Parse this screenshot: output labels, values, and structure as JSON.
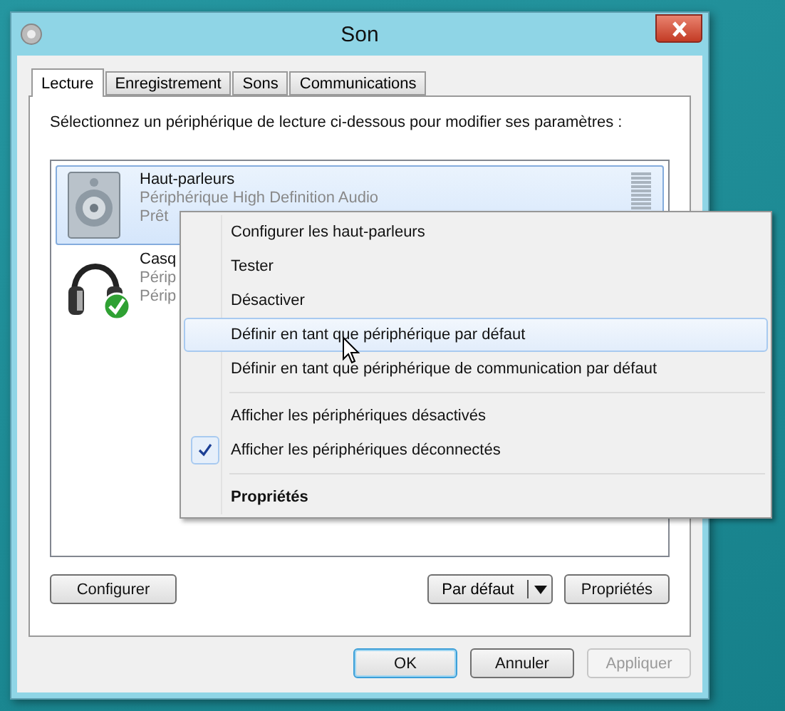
{
  "window": {
    "title": "Son"
  },
  "tabs": [
    {
      "label": "Lecture",
      "selected": true
    },
    {
      "label": "Enregistrement",
      "selected": false
    },
    {
      "label": "Sons",
      "selected": false
    },
    {
      "label": "Communications",
      "selected": false
    }
  ],
  "instruction": "Sélectionnez un périphérique de lecture ci-dessous pour modifier ses paramètres :",
  "devices": [
    {
      "kind": "speaker",
      "name": "Haut-parleurs",
      "description": "Périphérique High Definition Audio",
      "status": "Prêt",
      "selected": true,
      "default": false
    },
    {
      "kind": "headphones",
      "name": "Casq",
      "description": "Périp",
      "status": "Périp",
      "selected": false,
      "default": true
    }
  ],
  "panel_buttons": {
    "configure": "Configurer",
    "set_default": "Par défaut",
    "properties": "Propriétés"
  },
  "dialog_buttons": [
    {
      "label": "OK",
      "disabled": false,
      "focused": true
    },
    {
      "label": "Annuler",
      "disabled": false,
      "focused": false
    },
    {
      "label": "Appliquer",
      "disabled": true,
      "focused": false
    }
  ],
  "context_menu": [
    [
      {
        "label": "Configurer les haut-parleurs",
        "highlighted": false,
        "checked": false,
        "bold": false
      },
      {
        "label": "Tester",
        "highlighted": false,
        "checked": false,
        "bold": false
      },
      {
        "label": "Désactiver",
        "highlighted": false,
        "checked": false,
        "bold": false
      },
      {
        "label": "Définir en tant que périphérique par défaut",
        "highlighted": true,
        "checked": false,
        "bold": false
      },
      {
        "label": "Définir en tant que périphérique de communication par défaut",
        "highlighted": false,
        "checked": false,
        "bold": false
      }
    ],
    [
      {
        "label": "Afficher les périphériques désactivés",
        "highlighted": false,
        "checked": false,
        "bold": false
      },
      {
        "label": "Afficher les périphériques déconnectés",
        "highlighted": false,
        "checked": true,
        "bold": false
      }
    ],
    [
      {
        "label": "Propriétés",
        "highlighted": false,
        "checked": false,
        "bold": true
      }
    ]
  ]
}
